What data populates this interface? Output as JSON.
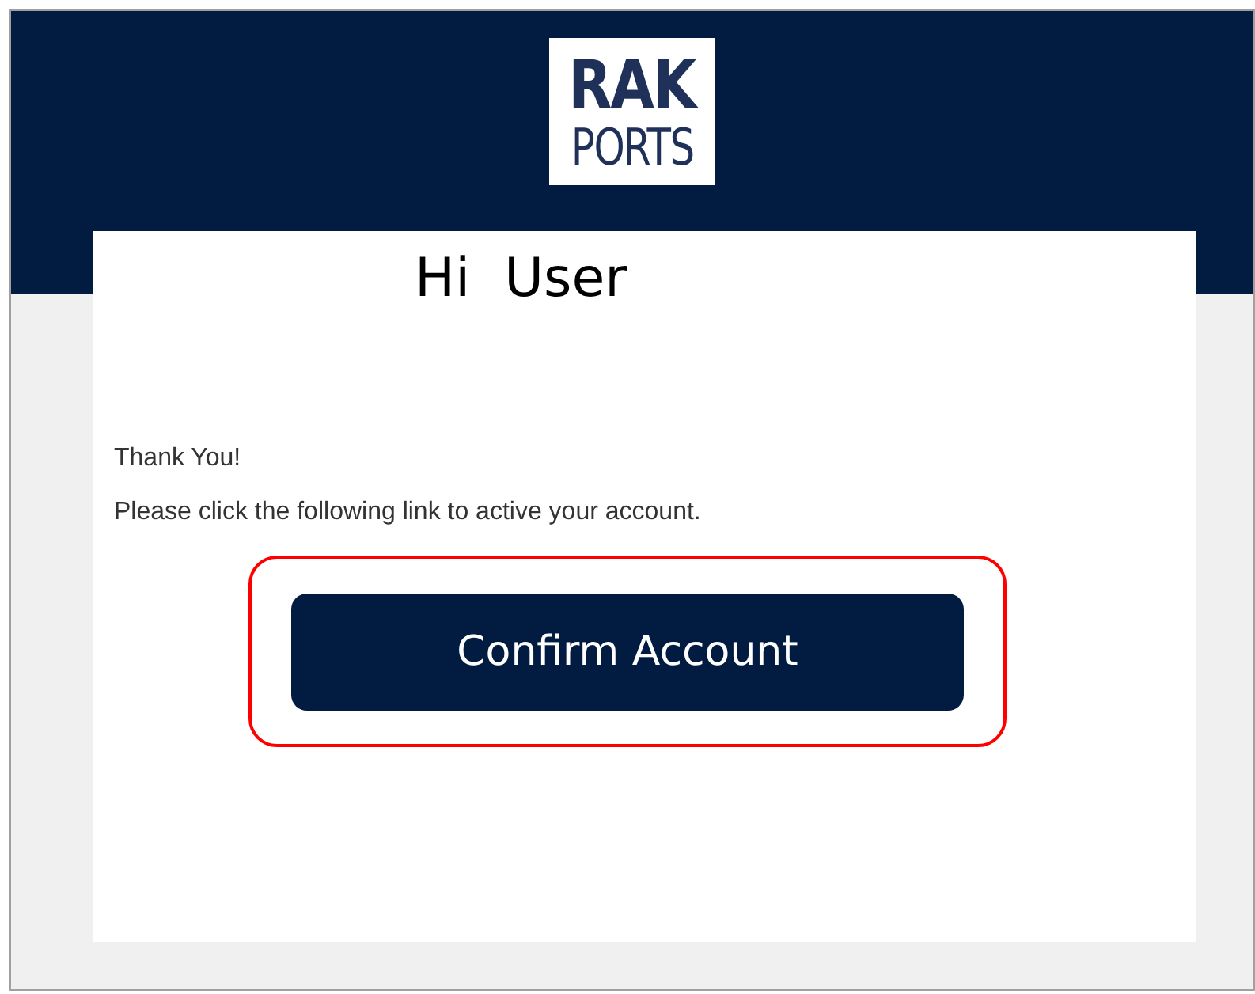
{
  "logo": {
    "line_1": "RAK",
    "line_2": "PORTS"
  },
  "greeting": "Hi  User",
  "paragraphs": [
    "Thank You!",
    "Please click the following link to active your account."
  ],
  "button": {
    "label": "Confirm Account",
    "highlighted": true
  }
}
